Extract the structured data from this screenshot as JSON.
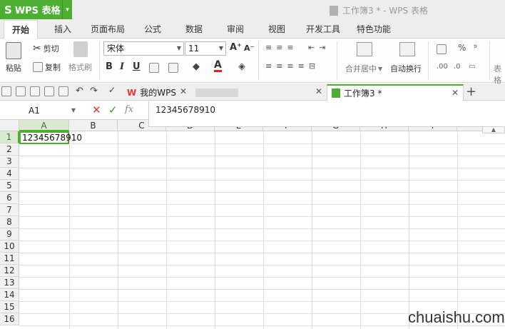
{
  "app": {
    "name": "WPS 表格",
    "logo_glyph": "S",
    "dropdown_glyph": "▾"
  },
  "window_title": "工作簿3 * - WPS 表格",
  "menu_tabs": [
    {
      "label": "开始",
      "active": true
    },
    {
      "label": "插入"
    },
    {
      "label": "页面布局"
    },
    {
      "label": "公式"
    },
    {
      "label": "数据"
    },
    {
      "label": "审阅"
    },
    {
      "label": "视图"
    },
    {
      "label": "开发工具"
    },
    {
      "label": "特色功能"
    }
  ],
  "ribbon": {
    "paste_label": "粘贴",
    "cut_label": "剪切",
    "copy_label": "复制",
    "format_painter_label": "格式刷",
    "font_name": "宋体",
    "font_size": "11",
    "grow_font": "A⁺",
    "shrink_font": "A⁻",
    "bold": "B",
    "italic": "I",
    "underline": "U",
    "merge_center_label": "合并居中",
    "wrap_text_label": "自动换行",
    "percent": "%",
    "thousands": "⁹",
    "cut_partial_label": "表格"
  },
  "document_tabs": [
    {
      "label": "我的WPS",
      "icon": "W"
    },
    {
      "label": ""
    },
    {
      "label": "工作簿3 *",
      "active": true
    }
  ],
  "formula_bar": {
    "cell_ref": "A1",
    "cancel_glyph": "✕",
    "confirm_glyph": "✓",
    "fx_glyph": "fx",
    "value": "12345678910"
  },
  "grid": {
    "columns": [
      "A",
      "B",
      "C",
      "D",
      "E",
      "F",
      "G",
      "H",
      "I"
    ],
    "rows": [
      "1",
      "2",
      "3",
      "4",
      "5",
      "6",
      "7",
      "8",
      "9",
      "10",
      "11",
      "12",
      "13",
      "14",
      "15",
      "16"
    ],
    "selected_cell": "A1",
    "cell_A1": "12345678910"
  },
  "watermark": "chuaishu.com"
}
